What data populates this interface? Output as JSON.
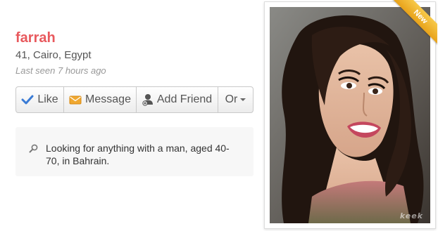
{
  "profile": {
    "name": "farrah",
    "details": "41, Cairo, Egypt",
    "last_seen": "Last seen 7 hours ago"
  },
  "actions": {
    "like_label": "Like",
    "message_label": "Message",
    "add_friend_label": "Add Friend",
    "more_label": "Or"
  },
  "about": {
    "text": "Looking for anything with a man, aged 40-70, in Bahrain."
  },
  "photo": {
    "badge": "New",
    "watermark": "keek"
  },
  "colors": {
    "name": "#e8595d",
    "like_icon": "#3a7bd5",
    "message_icon": "#f0a830",
    "badge": "#f0b432"
  },
  "icons": {
    "like": "checkmark-icon",
    "message": "envelope-icon",
    "add_friend": "add-person-icon",
    "more": "caret-down-icon",
    "about": "search-icon"
  }
}
